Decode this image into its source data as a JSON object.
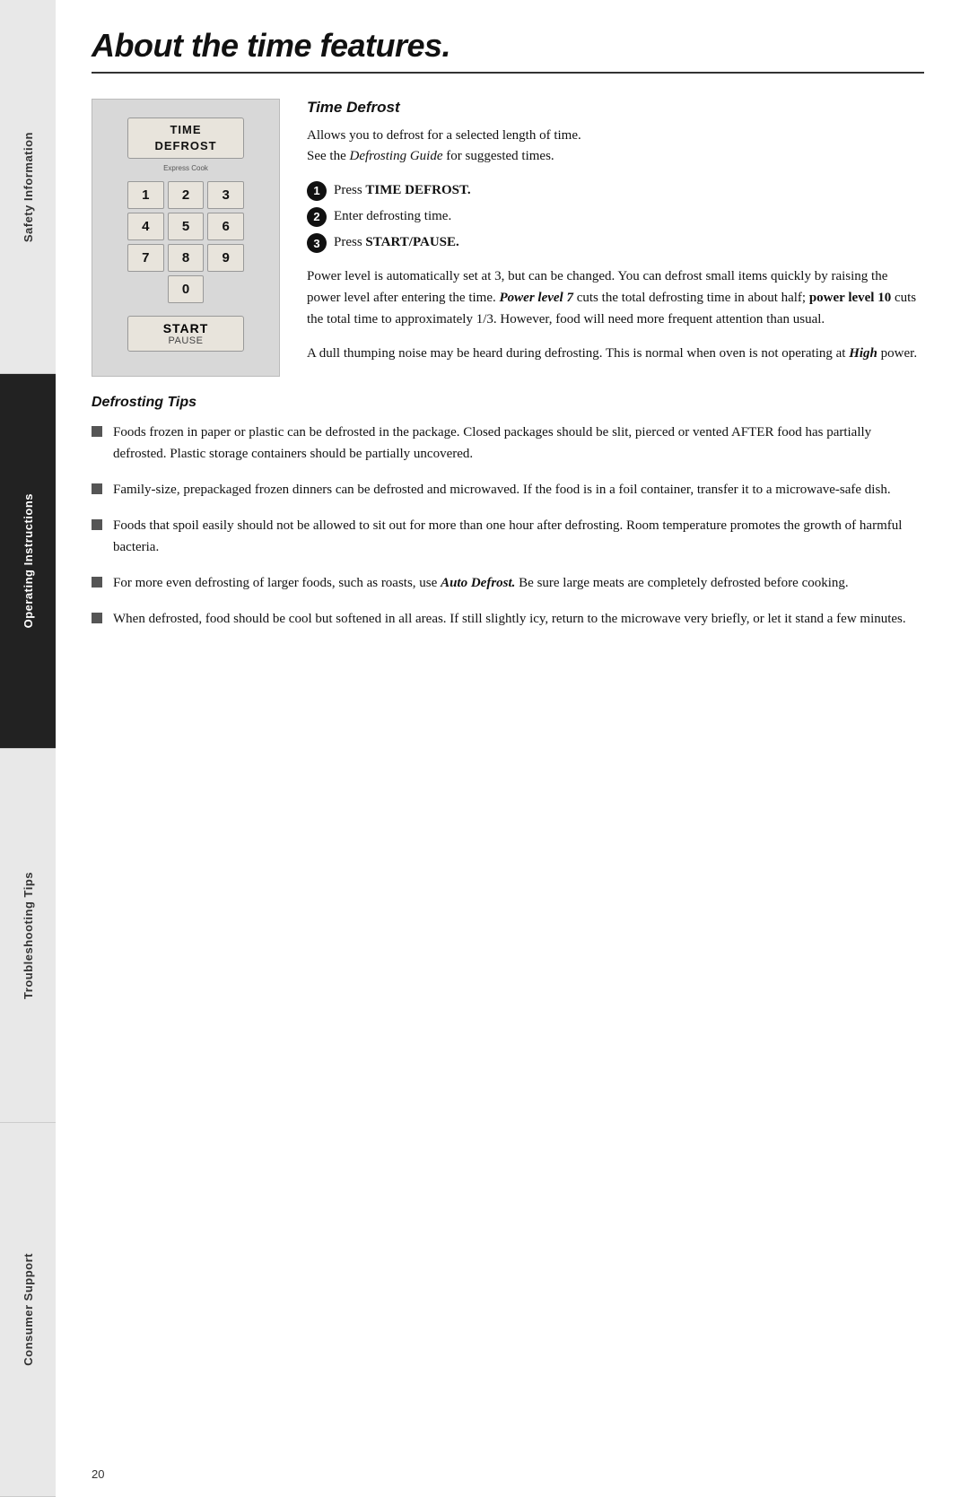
{
  "sidebar": {
    "sections": [
      {
        "id": "safety",
        "label": "Safety Information",
        "active": false
      },
      {
        "id": "operating",
        "label": "Operating Instructions",
        "active": true
      },
      {
        "id": "troubleshooting",
        "label": "Troubleshooting Tips",
        "active": false
      },
      {
        "id": "consumer",
        "label": "Consumer Support",
        "active": false
      }
    ]
  },
  "page": {
    "title": "About the time features.",
    "number": "20"
  },
  "keypad": {
    "time_defrost_label_line1": "Time",
    "time_defrost_label_line2": "Defrost",
    "express_cook_label": "Express Cook",
    "keys": [
      "1",
      "2",
      "3",
      "4",
      "5",
      "6",
      "7",
      "8",
      "9",
      "0"
    ],
    "start_label": "Start",
    "pause_label": "Pause"
  },
  "time_defrost": {
    "section_title": "Time Defrost",
    "intro_line1": "Allows you to defrost for a selected length of time.",
    "intro_line2": "See the ",
    "intro_italic": "Defrosting Guide",
    "intro_line3": " for suggested times.",
    "steps": [
      {
        "number": "1",
        "text_prefix": "Press ",
        "bold": "TIME DEFROST.",
        "suffix": ""
      },
      {
        "number": "2",
        "text_prefix": "Enter defrosting time.",
        "bold": "",
        "suffix": ""
      },
      {
        "number": "3",
        "text_prefix": "Press ",
        "bold": "START/PAUSE.",
        "suffix": ""
      }
    ],
    "para1": "Power level is automatically set at 3, but can be changed. You can defrost small items quickly by raising the power level after entering the time. ",
    "para1_bold1": "Power level 7",
    "para1_mid": " cuts the total defrosting time in about half; ",
    "para1_bold2": "power level 10",
    "para1_end": " cuts the total time to approximately 1/3. However, food will need more frequent attention than usual.",
    "para2_start": "A dull thumping noise may be heard during defrosting. This is normal when oven is not operating at ",
    "para2_bold": "High",
    "para2_end": " power."
  },
  "defrosting_tips": {
    "title": "Defrosting Tips",
    "items": [
      "Foods frozen in paper or plastic can be defrosted in the package. Closed packages should be slit, pierced or vented AFTER food has partially defrosted. Plastic storage containers should be partially uncovered.",
      "Family-size, prepackaged frozen dinners can be defrosted and microwaved. If the food is in a foil container, transfer it to a microwave-safe dish.",
      "Foods that spoil easily should not be allowed to sit out for more than one hour after defrosting. Room temperature promotes the growth of harmful bacteria.",
      "For more even defrosting of larger foods, such as roasts, use Auto Defrost. Be sure large meats are completely defrosted before cooking.",
      "When defrosted, food should be cool but softened in all areas. If still slightly icy, return to the microwave very briefly, or let it stand a few minutes."
    ],
    "items_bold_word": [
      "",
      "",
      "",
      "Auto Defrost.",
      ""
    ]
  }
}
